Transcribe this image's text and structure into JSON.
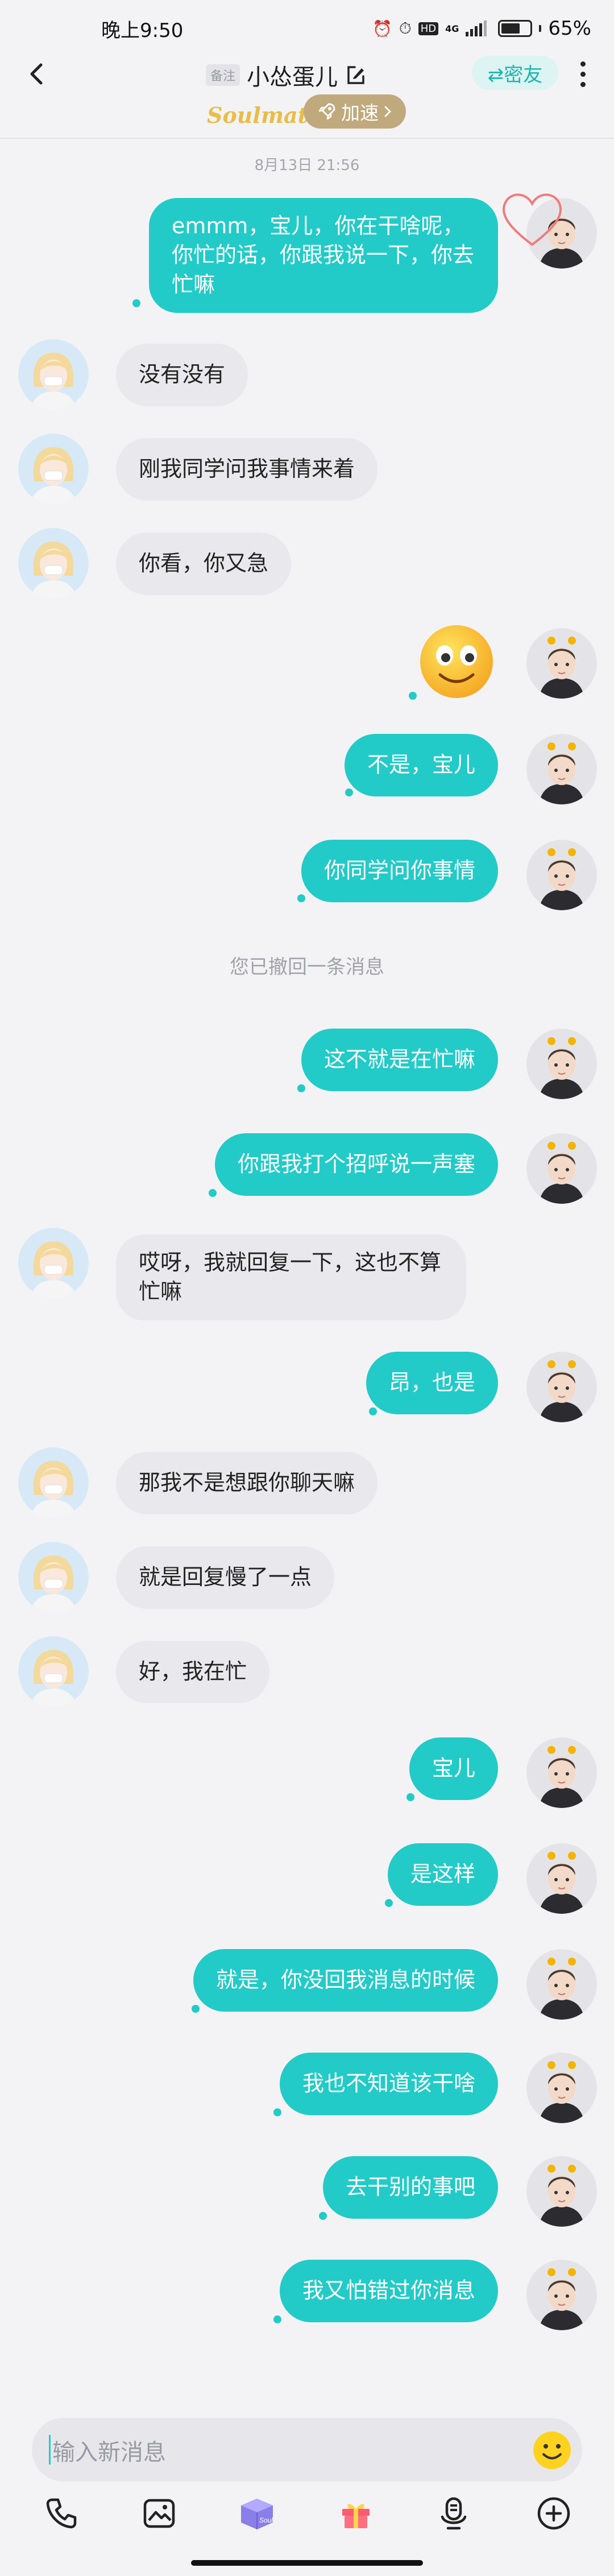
{
  "status": {
    "time": "晚上9:50",
    "network": "4G",
    "battery": "65%"
  },
  "header": {
    "remark_tag": "备注",
    "name": "小怂蛋儿",
    "friend_label": "⇄密友",
    "brand": "Soulmate",
    "speed_label": "加速"
  },
  "chat": {
    "timestamp": "8月13日 21:56",
    "notice": "您已撤回一条消息",
    "messages": [
      {
        "from": "me",
        "text": "emmm，宝儿，你在干啥呢，你忙的话，你跟我说一下，你去忙嘛"
      },
      {
        "from": "them",
        "text": "没有没有"
      },
      {
        "from": "them",
        "text": "刚我同学问我事情来着"
      },
      {
        "from": "them",
        "text": "你看，你又急"
      },
      {
        "from": "me",
        "type": "emoji",
        "emoji": "smiling-face-emoji"
      },
      {
        "from": "me",
        "text": "不是，宝儿"
      },
      {
        "from": "me",
        "text": "你同学问你事情"
      },
      {
        "from": "me",
        "text": "这不就是在忙嘛"
      },
      {
        "from": "me",
        "text": "你跟我打个招呼说一声塞"
      },
      {
        "from": "them",
        "text": "哎呀，我就回复一下，这也不算忙嘛"
      },
      {
        "from": "me",
        "text": "昂，也是"
      },
      {
        "from": "them",
        "text": "那我不是想跟你聊天嘛"
      },
      {
        "from": "them",
        "text": "就是回复慢了一点"
      },
      {
        "from": "them",
        "text": "好，我在忙"
      },
      {
        "from": "me",
        "text": "宝儿"
      },
      {
        "from": "me",
        "text": "是这样"
      },
      {
        "from": "me",
        "text": "就是，你没回我消息的时候"
      },
      {
        "from": "me",
        "text": "我也不知道该干啥"
      },
      {
        "from": "me",
        "text": "去干别的事吧"
      },
      {
        "from": "me",
        "text": "我又怕错过你消息"
      }
    ]
  },
  "input": {
    "placeholder": "输入新消息"
  },
  "toolbar": {
    "items": [
      "phone-icon",
      "image-icon",
      "soul-box-icon",
      "gift-icon",
      "voice-icon",
      "add-icon"
    ]
  },
  "colors": {
    "accent": "#22cbc7",
    "incoming_bubble": "#e9e9ed",
    "background": "#f3f3f5",
    "brand": "#e9bd47",
    "speed_badge": "#c0a97c"
  }
}
